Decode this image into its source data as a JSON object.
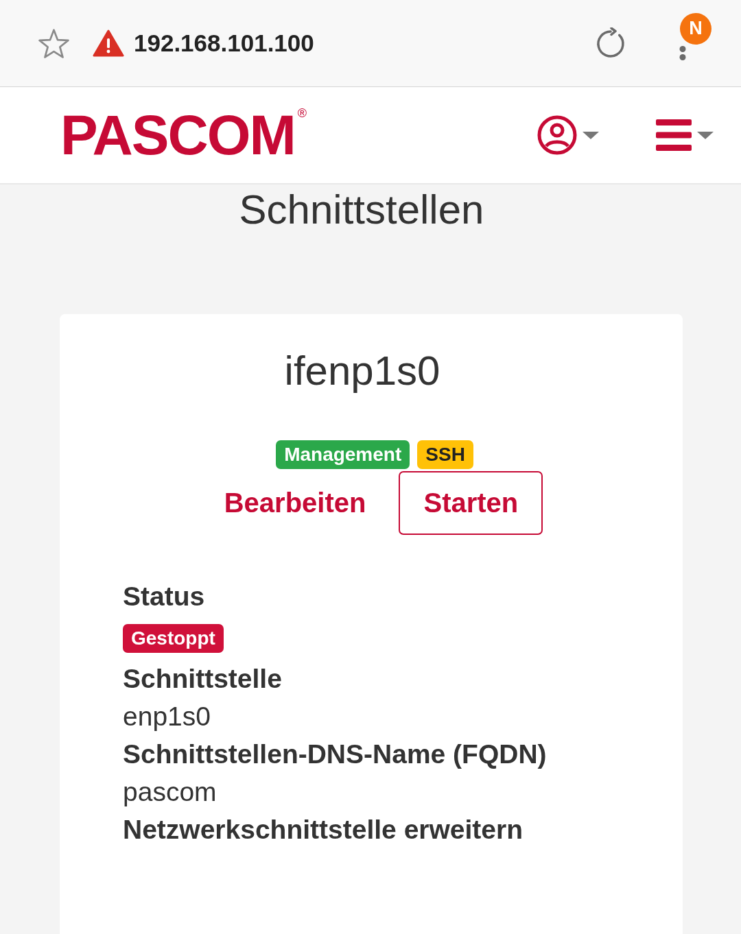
{
  "browser_bar": {
    "url": "192.168.101.100",
    "profile_initial": "N"
  },
  "header": {
    "logo": "PASCOM$^{®}$"
  },
  "page_title": "Schnittstellen",
  "card": {
    "title": "ifenp1s0",
    "tags": [
      {
        "label": "Management",
        "color": "#2ba84a"
      },
      {
        "label": "SSH",
        "color": "#ffc107"
      }
    ],
    "actions": [
      {
        "label": "Bearbeiten",
        "kind": "link"
      },
      {
        "label": "Starten",
        "kind": "outline"
      }
    ],
    "fields": [
      {
        "kind": "badge",
        "label": "Status",
        "badge": "Gestoppt"
      },
      {
        "kind": "text",
        "label": "Schnittstelle",
        "value": "enp1s0"
      },
      {
        "kind": "text",
        "label": "Schnittstellen-DNS-Name (FQDN)",
        "value": "pascom"
      },
      {
        "kind": "heading",
        "label": "Netzwerkschnittstelle erweitern"
      }
    ]
  }
}
